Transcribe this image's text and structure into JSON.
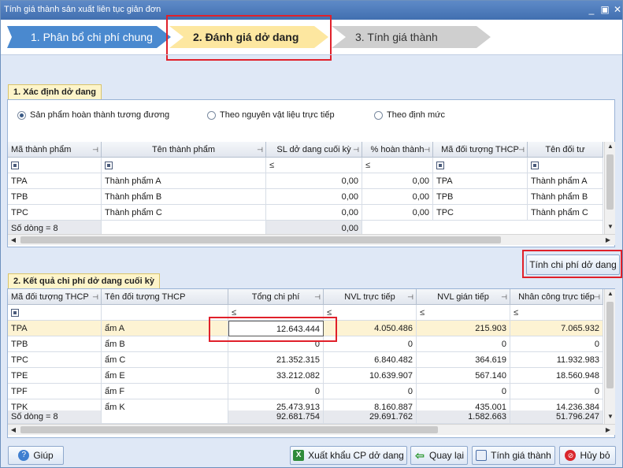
{
  "window": {
    "title": "Tính giá thành sản xuất liên tục giản đơn"
  },
  "steps": [
    "1. Phân bổ chi phí chung",
    "2. Đánh giá dở dang",
    "3. Tính giá thành"
  ],
  "section1": {
    "title": "1. Xác định dở dang",
    "radios": [
      {
        "label": "Sản phẩm hoàn thành tương đương",
        "checked": true
      },
      {
        "label": "Theo nguyên vật liệu trực tiếp",
        "checked": false
      },
      {
        "label": "Theo định mức",
        "checked": false
      }
    ],
    "columns": [
      "Mã thành phẩm",
      "Tên thành phẩm",
      "SL dở dang cuối kỳ",
      "% hoàn thành",
      "Mã đối tượng THCP",
      "Tên đối tư"
    ],
    "filter_le": "≤",
    "rows": [
      [
        "TPA",
        "Thành phẩm A",
        "0,00",
        "0,00",
        "TPA",
        "Thành phẩm A"
      ],
      [
        "TPB",
        "Thành phẩm B",
        "0,00",
        "0,00",
        "TPB",
        "Thành phẩm B"
      ],
      [
        "TPC",
        "Thành phẩm C",
        "0,00",
        "0,00",
        "TPC",
        "Thành phẩm C"
      ]
    ],
    "summary": {
      "label": "Số dòng = 8",
      "sl_total": "0,00"
    }
  },
  "calc_button": "Tính chi phí dở dang",
  "section2": {
    "title": "2. Kết quả chi phí dở dang cuối kỳ",
    "columns": [
      "Mã đối tượng THCP",
      "Tên đối tượng THCP",
      "Tổng chi phí",
      "NVL trực tiếp",
      "NVL gián tiếp",
      "Nhân công trực tiếp"
    ],
    "filter_le": "≤",
    "rows": [
      [
        "TPA",
        "ẩm A",
        "12.643.444",
        "4.050.486",
        "215.903",
        "7.065.932"
      ],
      [
        "TPB",
        "ẩm B",
        "0",
        "0",
        "0",
        "0"
      ],
      [
        "TPC",
        "ẩm C",
        "21.352.315",
        "6.840.482",
        "364.619",
        "11.932.983"
      ],
      [
        "TPE",
        "ẩm E",
        "33.212.082",
        "10.639.907",
        "567.140",
        "18.560.948"
      ],
      [
        "TPF",
        "ẩm F",
        "0",
        "0",
        "0",
        "0"
      ],
      [
        "TPK",
        "ẩm K",
        "25.473.913",
        "8.160.887",
        "435.001",
        "14.236.384"
      ]
    ],
    "summary": {
      "label": "Số dòng = 8",
      "tong": "92.681.754",
      "nvl_tt": "29.691.762",
      "nvl_gt": "1.582.663",
      "nc_tt": "51.796.247"
    }
  },
  "buttons": {
    "help": "Giúp",
    "export": "Xuất khẩu CP dở dang",
    "back": "Quay lại",
    "next": "Tính giá thành",
    "cancel": "Hủy bỏ"
  },
  "colors": {
    "accent": "#4a89cf",
    "active_step": "#fde7a0",
    "highlight": "#e0202a"
  }
}
